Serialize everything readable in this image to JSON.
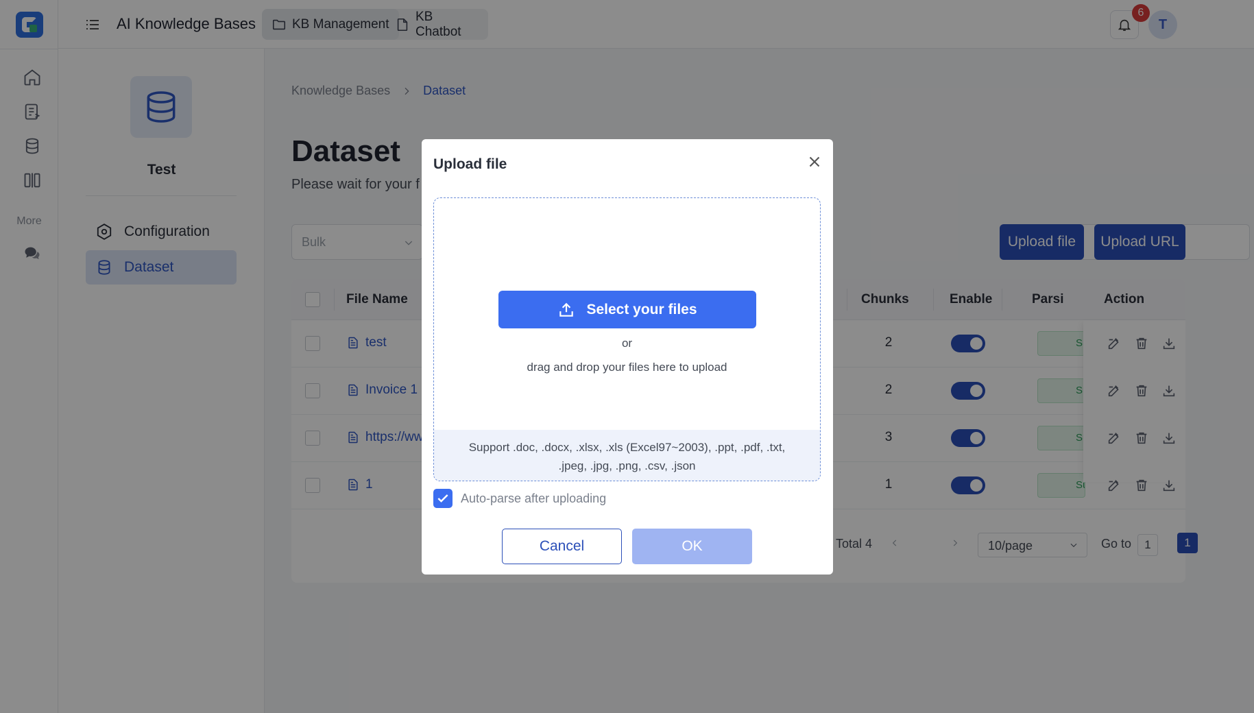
{
  "app": {
    "title": "AI Knowledge Bases"
  },
  "nav_tabs": [
    {
      "label": "KB Management",
      "icon": "folder-icon"
    },
    {
      "label": "KB Chatbot",
      "icon": "file-icon"
    }
  ],
  "rail": {
    "more_label": "More"
  },
  "notifications": {
    "count": "6"
  },
  "user": {
    "initial": "T"
  },
  "kb": {
    "name": "Test",
    "nav": [
      {
        "label": "Configuration",
        "icon": "gear-icon"
      },
      {
        "label": "Dataset",
        "icon": "database-icon"
      }
    ]
  },
  "breadcrumb": {
    "root": "Knowledge Bases",
    "current": "Dataset"
  },
  "page": {
    "title": "Dataset",
    "subtitle": "Please wait for your f"
  },
  "toolbar": {
    "bulk_placeholder": "Bulk",
    "upload_file_label": "Upload file",
    "upload_url_label": "Upload URL"
  },
  "table": {
    "columns": {
      "file_name": "File Name",
      "chunks": "Chunks",
      "enable": "Enable",
      "parsing": "Parsi",
      "action": "Action"
    },
    "rows": [
      {
        "name": "test",
        "chunks": "2",
        "status": "Suc"
      },
      {
        "name": "Invoice 1",
        "chunks": "2",
        "status": "Suc"
      },
      {
        "name": "https://ww",
        "chunks": "3",
        "status": "Suc"
      },
      {
        "name": "1",
        "chunks": "1",
        "status": "Suc"
      }
    ]
  },
  "pagination": {
    "total": "Total 4",
    "current": "1",
    "per_page": "10/page",
    "goto_label": "Go to",
    "goto_value": "1"
  },
  "modal": {
    "title": "Upload file",
    "select_label": "Select your files",
    "or_text": "or",
    "drag_text": "drag and drop your files here to upload",
    "support_text": "Support .doc, .docx, .xlsx, .xls (Excel97~2003), .ppt, .pdf, .txt, .jpeg, .jpg, .png, .csv, .json",
    "auto_parse_label": "Auto-parse after uploading",
    "cancel_label": "Cancel",
    "ok_label": "OK"
  },
  "colors": {
    "primary": "#2b4fb8",
    "select_button": "#3b6df0",
    "ok_disabled": "#9fb4f2"
  }
}
